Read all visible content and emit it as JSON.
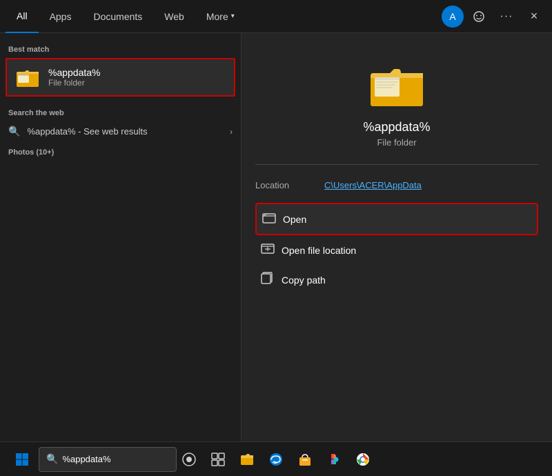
{
  "nav": {
    "tabs": [
      {
        "id": "all",
        "label": "All",
        "active": true
      },
      {
        "id": "apps",
        "label": "Apps",
        "active": false
      },
      {
        "id": "documents",
        "label": "Documents",
        "active": false
      },
      {
        "id": "web",
        "label": "Web",
        "active": false
      },
      {
        "id": "more",
        "label": "More",
        "active": false
      }
    ],
    "avatar_letter": "A",
    "close_label": "×",
    "ellipsis_label": "···"
  },
  "left_panel": {
    "best_match_label": "Best match",
    "best_match": {
      "name": "%appdata%",
      "type": "File folder"
    },
    "web_search_label": "Search the web",
    "web_search_text": "%appdata% - See web results",
    "photos_label": "Photos (10+)"
  },
  "right_panel": {
    "item_name": "%appdata%",
    "item_type": "File folder",
    "location_label": "Location",
    "location_value": "C\\Users\\ACER\\AppData",
    "actions": [
      {
        "id": "open",
        "label": "Open",
        "highlighted": true
      },
      {
        "id": "open-file-location",
        "label": "Open file location",
        "highlighted": false
      },
      {
        "id": "copy-path",
        "label": "Copy path",
        "highlighted": false
      }
    ]
  },
  "taskbar": {
    "search_value": "%appdata%",
    "search_placeholder": "%appdata%"
  }
}
